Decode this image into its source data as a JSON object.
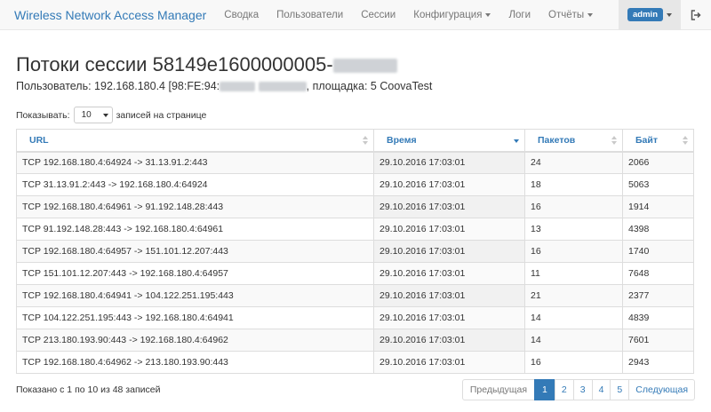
{
  "navbar": {
    "brand": "Wireless Network Access Manager",
    "items": [
      {
        "label": "Сводка"
      },
      {
        "label": "Пользователи"
      },
      {
        "label": "Сессии"
      },
      {
        "label": "Конфигурация"
      },
      {
        "label": "Логи"
      },
      {
        "label": "Отчёты"
      }
    ],
    "user_badge": "admin",
    "logout_icon": "sign-out-icon"
  },
  "page": {
    "title_prefix": "Потоки сессии 58149e1600000005-",
    "subtitle_prefix": "Пользователь: 192.168.180.4 [98:FE:94:",
    "subtitle_suffix": ", площадка: 5 CoovaTest"
  },
  "length": {
    "prefix": "Показывать:",
    "value": "10",
    "suffix": "записей на странице"
  },
  "table": {
    "columns": [
      "URL",
      "Время",
      "Пакетов",
      "Байт"
    ],
    "rows": [
      [
        "TCP 192.168.180.4:64924 -> 31.13.91.2:443",
        "29.10.2016 17:03:01",
        "24",
        "2066"
      ],
      [
        "TCP 31.13.91.2:443 -> 192.168.180.4:64924",
        "29.10.2016 17:03:01",
        "18",
        "5063"
      ],
      [
        "TCP 192.168.180.4:64961 -> 91.192.148.28:443",
        "29.10.2016 17:03:01",
        "16",
        "1914"
      ],
      [
        "TCP 91.192.148.28:443 -> 192.168.180.4:64961",
        "29.10.2016 17:03:01",
        "13",
        "4398"
      ],
      [
        "TCP 192.168.180.4:64957 -> 151.101.12.207:443",
        "29.10.2016 17:03:01",
        "16",
        "1740"
      ],
      [
        "TCP 151.101.12.207:443 -> 192.168.180.4:64957",
        "29.10.2016 17:03:01",
        "11",
        "7648"
      ],
      [
        "TCP 192.168.180.4:64941 -> 104.122.251.195:443",
        "29.10.2016 17:03:01",
        "21",
        "2377"
      ],
      [
        "TCP 104.122.251.195:443 -> 192.168.180.4:64941",
        "29.10.2016 17:03:01",
        "14",
        "4839"
      ],
      [
        "TCP 213.180.193.90:443 -> 192.168.180.4:64962",
        "29.10.2016 17:03:01",
        "14",
        "7601"
      ],
      [
        "TCP 192.168.180.4:64962 -> 213.180.193.90:443",
        "29.10.2016 17:03:01",
        "16",
        "2943"
      ]
    ]
  },
  "footer": {
    "info": "Показано с 1 по 10 из 48 записей",
    "prev": "Предыдущая",
    "pages": [
      "1",
      "2",
      "3",
      "4",
      "5"
    ],
    "next": "Следующая"
  },
  "colors": {
    "link": "#337ab7",
    "navbar_bg": "#f8f8f8",
    "border": "#dddddd"
  }
}
